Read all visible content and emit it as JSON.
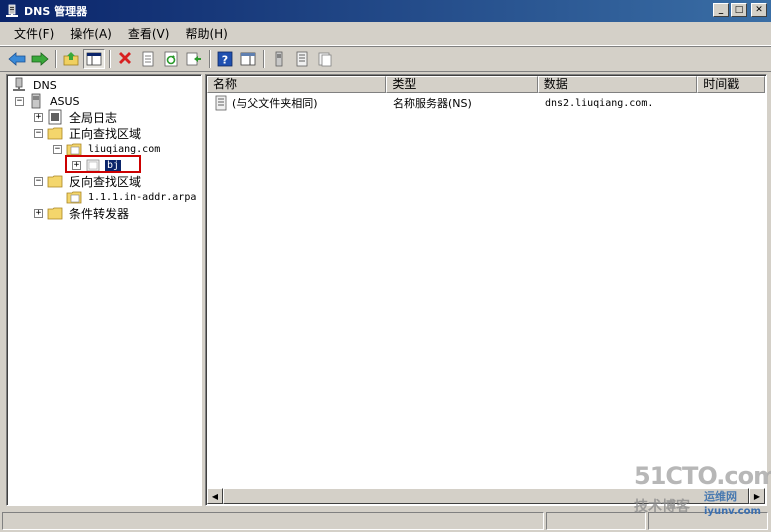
{
  "window": {
    "title": "DNS 管理器",
    "min": "_",
    "max": "□",
    "close": "✕"
  },
  "menu": [
    "文件(F)",
    "操作(A)",
    "查看(V)",
    "帮助(H)"
  ],
  "tree": {
    "root": "DNS",
    "server": "ASUS",
    "global_log": "全局日志",
    "forward_zone": "正向查找区域",
    "zone": "liuqiang.com",
    "subdomain": "bj",
    "reverse_zone": "反向查找区域",
    "reverse_entry": "1.1.1.in-addr.arpa",
    "forwarders": "条件转发器"
  },
  "list": {
    "columns": [
      "名称",
      "类型",
      "数据",
      "时间戳"
    ],
    "rows": [
      {
        "name": "(与父文件夹相同)",
        "type": "名称服务器(NS)",
        "data": "dns2.liuqiang.com."
      }
    ]
  },
  "watermark": {
    "brand": "51CTO.com",
    "tagline": "技术博客",
    "site": "运维网",
    "url": "iyunv.com"
  },
  "colors": {
    "titlebar": "#0a246a",
    "selection": "#0a246a",
    "highlight": "#cc0000"
  }
}
